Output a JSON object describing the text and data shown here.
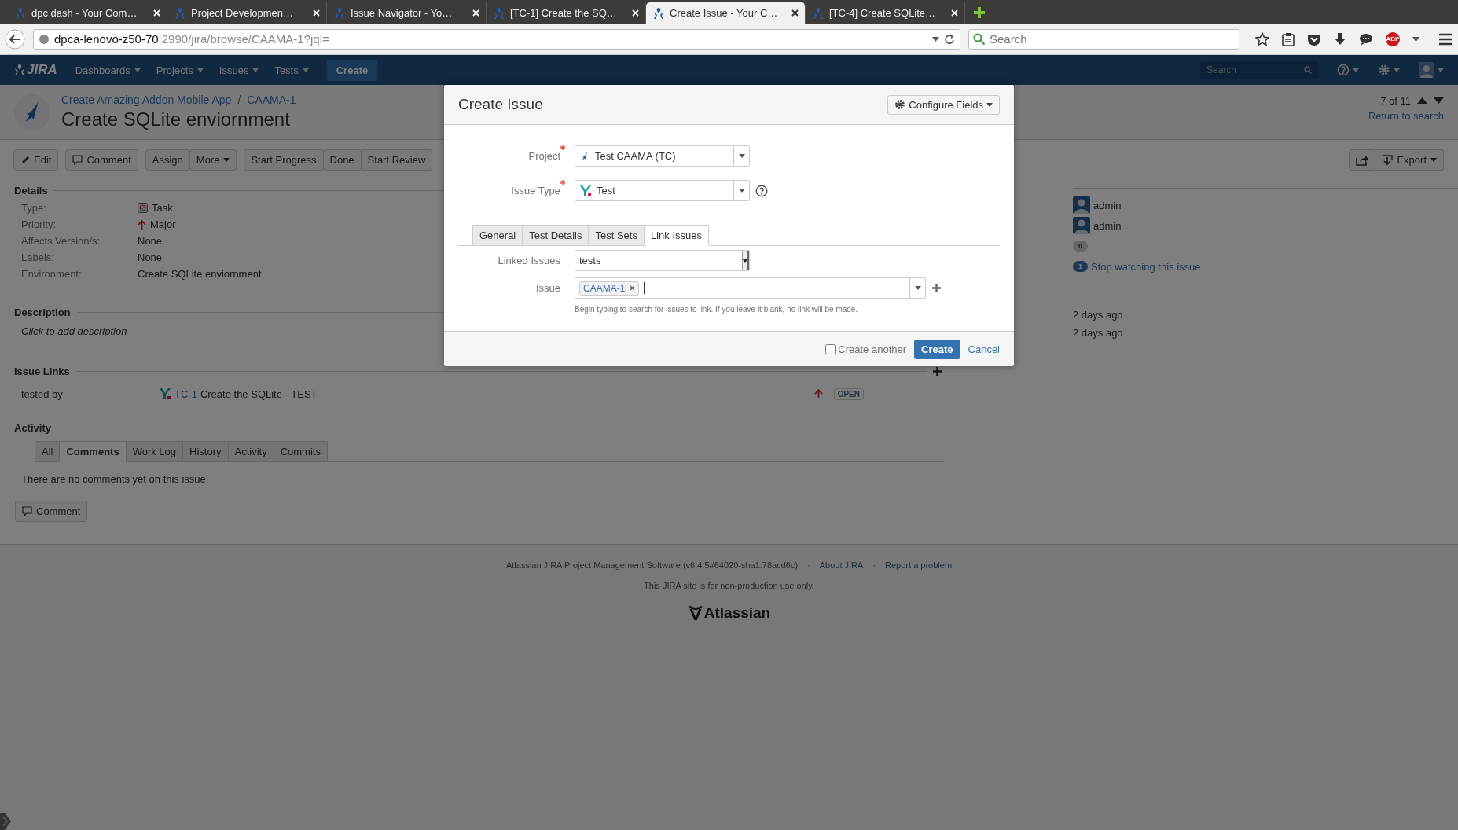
{
  "browser": {
    "tabs": [
      {
        "title": "dpc dash - Your Com…",
        "selected": false
      },
      {
        "title": "Project Developmen…",
        "selected": false
      },
      {
        "title": "Issue Navigator - Yo…",
        "selected": false
      },
      {
        "title": "[TC-1] Create the SQ…",
        "selected": false
      },
      {
        "title": "Create Issue - Your C…",
        "selected": true
      },
      {
        "title": "[TC-4] Create SQLite…",
        "selected": false
      }
    ],
    "address": {
      "host": "dpca-lenovo-z50-70",
      "path": ":2990/jira/browse/CAAMA-1?jql="
    },
    "search": {
      "placeholder": "Search"
    },
    "adblock_label": "ABP"
  },
  "jira_nav": {
    "logo": "JIRA",
    "menus": [
      "Dashboards",
      "Projects",
      "Issues",
      "Tests"
    ],
    "create_button": "Create",
    "search": {
      "placeholder": "Search"
    }
  },
  "issue": {
    "project": "Create Amazing Addon Mobile App",
    "separator": "/",
    "key": "CAAMA-1",
    "title": "Create SQLite enviornment",
    "position": "7 of 11",
    "return_link": "Return to search",
    "toolbar": [
      [
        {
          "kind": "edit",
          "label": "Edit"
        }
      ],
      [
        {
          "kind": "comment",
          "label": "Comment"
        }
      ],
      [
        {
          "kind": "plain",
          "label": "Assign"
        },
        {
          "kind": "dropdown",
          "label": "More"
        }
      ],
      [
        {
          "kind": "plain",
          "label": "Start Progress"
        },
        {
          "kind": "plain",
          "label": "Done"
        },
        {
          "kind": "plain",
          "label": "Start Review"
        }
      ]
    ],
    "toolbar_right": [
      {
        "kind": "share"
      },
      {
        "kind": "export",
        "label": "Export"
      }
    ],
    "details_title": "Details",
    "details": [
      {
        "label": "Type:",
        "value": "Task",
        "kind": "type"
      },
      {
        "label": "Priority:",
        "value": "Major",
        "kind": "priority"
      },
      {
        "label": "Affects Version/s:",
        "value": "None",
        "kind": "plain"
      },
      {
        "label": "Labels:",
        "value": "None",
        "kind": "plain"
      },
      {
        "label": "Environment:",
        "value": "Create SQLite enviornment",
        "kind": "plain"
      }
    ],
    "description_title": "Description",
    "description_placeholder": "Click to add description",
    "links_title": "Issue Links",
    "links": [
      {
        "relation": "tested by",
        "key": "TC-1",
        "summary": "Create the SQLite - TEST",
        "status": "OPEN"
      }
    ],
    "activity_title": "Activity",
    "activity_tabs": [
      {
        "label": "All",
        "selected": false
      },
      {
        "label": "Comments",
        "selected": true
      },
      {
        "label": "Work Log",
        "selected": false
      },
      {
        "label": "History",
        "selected": false
      },
      {
        "label": "Activity",
        "selected": false
      },
      {
        "label": "Commits",
        "selected": false
      }
    ],
    "no_comments": "There are no comments yet on this issue.",
    "comment_button": "Comment",
    "people": [
      "admin",
      "admin"
    ],
    "votes": "0",
    "watchers": {
      "count": "1",
      "label": "Stop watching this issue"
    },
    "dates": [
      "2 days ago",
      "2 days ago"
    ]
  },
  "footer": {
    "items": [
      {
        "kind": "text",
        "text": "Atlassian JIRA Project Management Software (v6.4.5#64020-sha1:78acd6c)"
      },
      {
        "kind": "separator",
        "text": "·"
      },
      {
        "kind": "link",
        "text": "About JIRA"
      },
      {
        "kind": "separator",
        "text": "·"
      },
      {
        "kind": "link",
        "text": "Report a problem"
      }
    ],
    "note": "This JIRA site is for non-production use only.",
    "logo": "Atlassian"
  },
  "dialog": {
    "title": "Create Issue",
    "configure_button": "Configure Fields",
    "project": {
      "label": "Project",
      "required": true,
      "value": "Test CAAMA (TC)"
    },
    "issue_type": {
      "label": "Issue Type",
      "required": true,
      "value": "Test"
    },
    "tabs": [
      {
        "label": "General",
        "selected": false
      },
      {
        "label": "Test Details",
        "selected": false
      },
      {
        "label": "Test Sets",
        "selected": false
      },
      {
        "label": "Link Issues",
        "selected": true
      }
    ],
    "linked_issues": {
      "label": "Linked Issues",
      "value": "tests"
    },
    "issue": {
      "label": "Issue",
      "tokens": [
        "CAAMA-1"
      ],
      "hint": "Begin typing to search for issues to link. If you leave it blank, no link will be made."
    },
    "create_another": {
      "label": "Create another",
      "checked": false
    },
    "create_button": "Create",
    "cancel": "Cancel"
  }
}
